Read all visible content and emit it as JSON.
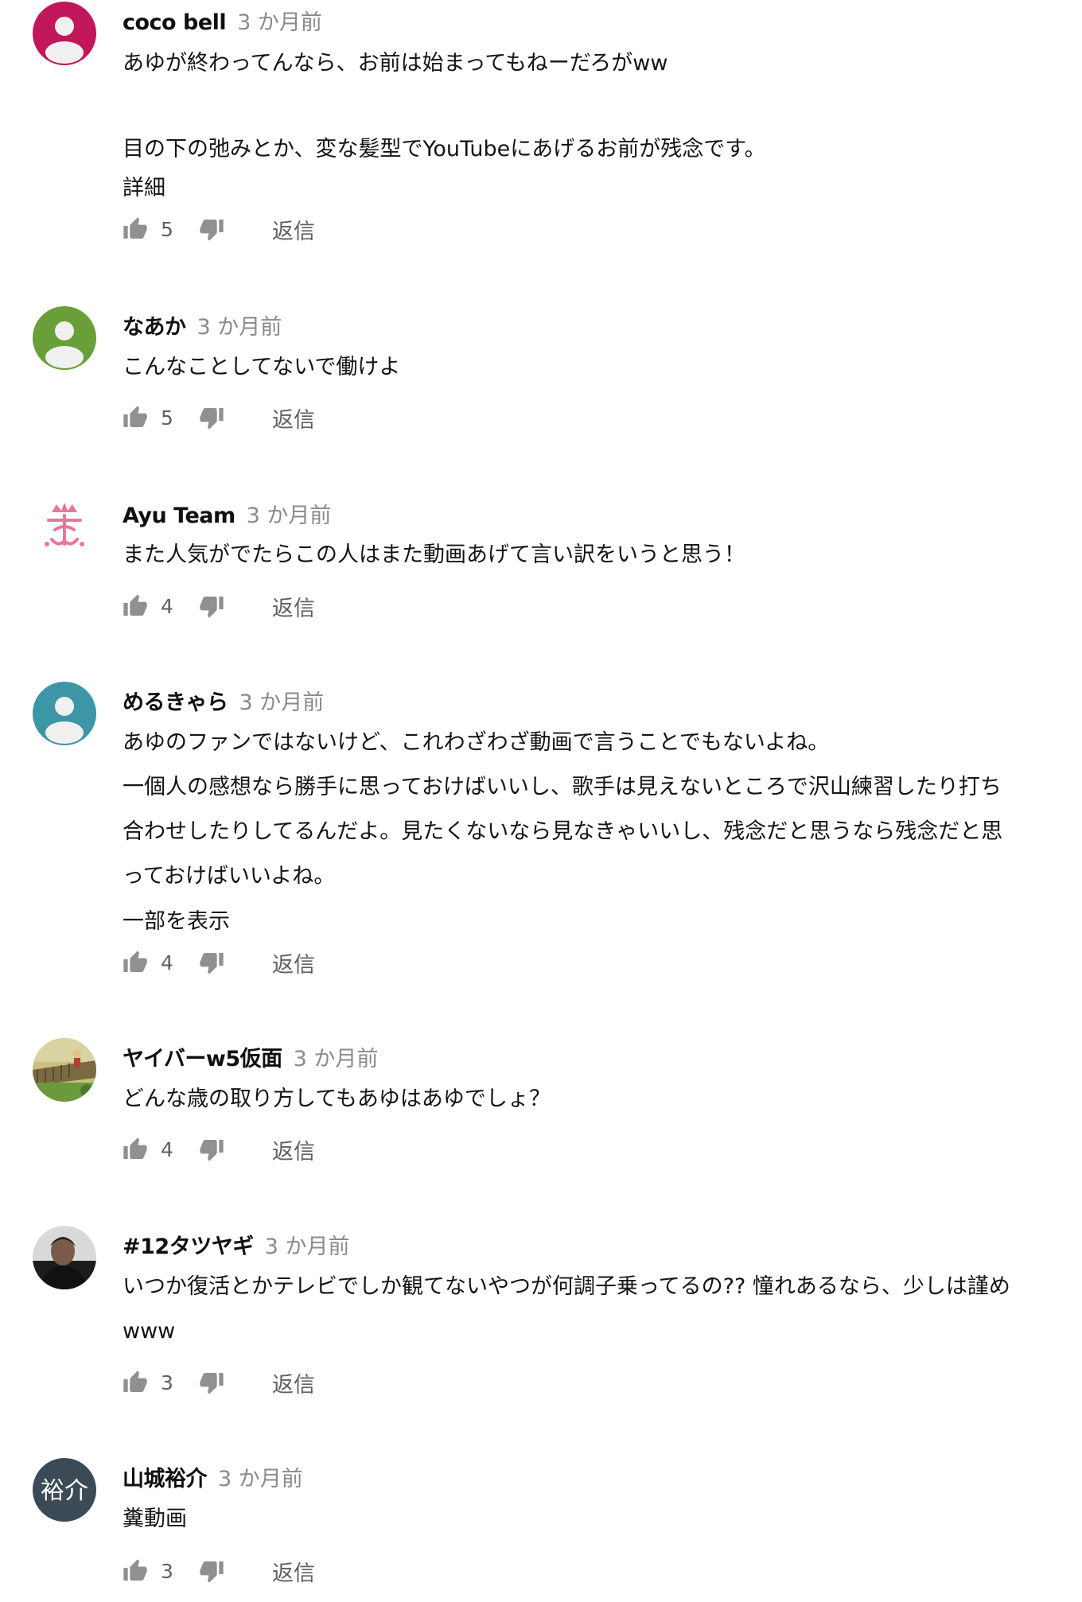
{
  "comments": [
    {
      "author": "coco bell",
      "time": "3 か月前",
      "lines": [
        "あゆが終わってんなら、お前は始まってもねーだろがww",
        "",
        "目の下の弛みとか、変な髪型でYouTubeにあげるお前が残念です。"
      ],
      "more": "詳細",
      "likes": "5",
      "reply": "返信",
      "avatar": {
        "type": "default",
        "color": "#c2185b"
      }
    },
    {
      "author": "なあか",
      "time": "3 か月前",
      "lines": [
        "こんなことしてないで働けよ"
      ],
      "more": "",
      "likes": "5",
      "reply": "返信",
      "avatar": {
        "type": "default",
        "color": "#689f38"
      }
    },
    {
      "author": "Ayu Team",
      "time": "3 か月前",
      "lines": [
        "また人気がでたらこの人はまた動画あげて言い訳をいうと思う！"
      ],
      "more": "",
      "likes": "4",
      "reply": "返信",
      "avatar": {
        "type": "logo",
        "color": "#e8769a"
      }
    },
    {
      "author": "めるきゃら",
      "time": "3 か月前",
      "lines": [
        "あゆのファンではないけど、これわざわざ動画で言うことでもないよね。",
        "一個人の感想なら勝手に思っておけばいいし、歌手は見えないところで沢山練習したり打ち",
        "合わせしたりしてるんだよ。見たくないなら見なきゃいいし、残念だと思うなら残念だと思",
        "っておけばいいよね。"
      ],
      "more": "一部を表示",
      "likes": "4",
      "reply": "返信",
      "avatar": {
        "type": "default",
        "color": "#3d96a6"
      }
    },
    {
      "author": "ヤイバーw5仮面",
      "time": "3 か月前",
      "lines": [
        "どんな歳の取り方してもあゆはあゆでしょ？"
      ],
      "more": "",
      "likes": "4",
      "reply": "返信",
      "avatar": {
        "type": "photo-garden",
        "color": "#8a9a4a"
      }
    },
    {
      "author": "#12タツヤギ",
      "time": "3 か月前",
      "lines": [
        "いつか復活とかテレビでしか観てないやつが何調子乗ってるの?? 憧れあるなら、少しは謹め",
        "www"
      ],
      "more": "",
      "likes": "3",
      "reply": "返信",
      "avatar": {
        "type": "photo-person",
        "color": "#2a2a2a"
      }
    },
    {
      "author": "山城裕介",
      "time": "3 か月前",
      "lines": [
        "糞動画"
      ],
      "more": "",
      "likes": "3",
      "reply": "返信",
      "avatar": {
        "type": "text",
        "text": "裕介",
        "color": "#3b4a55"
      }
    }
  ]
}
